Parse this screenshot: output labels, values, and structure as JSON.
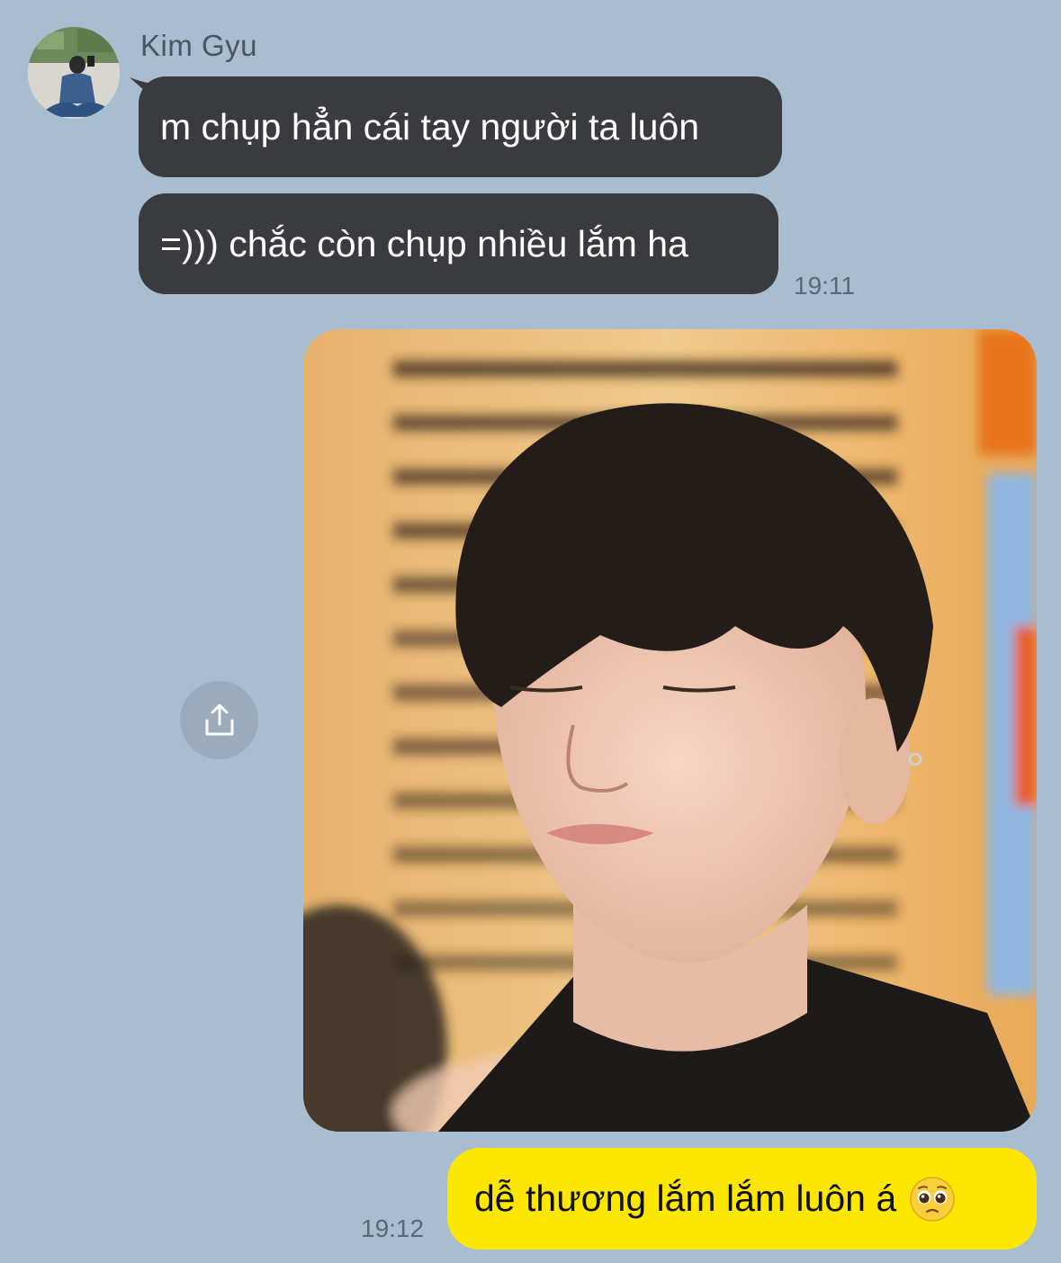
{
  "chat": {
    "sender_name": "Kim Gyu",
    "incoming": [
      {
        "text": "m chụp hẳn cái tay người ta luôn"
      },
      {
        "text": "=))) chắc còn chụp nhiều lắm ha"
      }
    ],
    "incoming_time": "19:11",
    "outgoing_text": "dễ thương lắm lắm luôn á",
    "outgoing_emoji": "pleading-face-icon",
    "outgoing_time": "19:12"
  },
  "colors": {
    "background": "#a9bdd1",
    "incoming_bubble": "#3a3b3e",
    "outgoing_bubble": "#fde600",
    "timestamp": "#5b6874"
  },
  "icons": {
    "share": "share-icon",
    "avatar": "avatar"
  }
}
